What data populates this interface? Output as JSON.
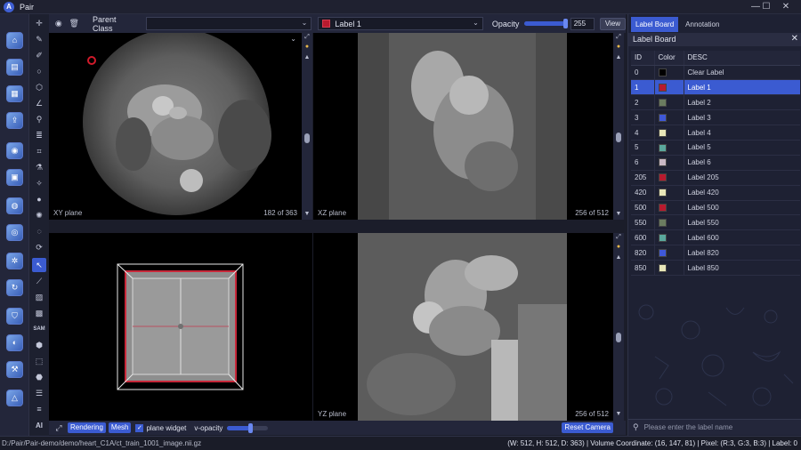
{
  "window": {
    "title": "Pair",
    "logo_letter": "A"
  },
  "window_controls": {
    "minimize": "—",
    "maximize": "☐",
    "close": "✕"
  },
  "top_toolbar": {
    "parent_class_label": "Parent Class",
    "parent_class_value": "",
    "label_select": {
      "text": "Label 1",
      "color": "#b81a2e"
    },
    "opacity_label": "Opacity",
    "opacity_value": "255",
    "opacity_fraction": 1.0,
    "view_button": "View"
  },
  "viewports": {
    "xy": {
      "label": "XY plane",
      "count": "182 of 363"
    },
    "xz": {
      "label": "XZ plane",
      "count": "256 of 512"
    },
    "yz": {
      "label": "YZ plane",
      "count": "256 of 512"
    }
  },
  "viewport_bar": {
    "rendering": "Rendering",
    "mesh": "Mesh",
    "plane_widget": "plane widget",
    "v_opacity_label": "v-opacity",
    "v_opacity_fraction": 0.55,
    "reset_camera": "Reset Camera"
  },
  "tool_column": {
    "sam_label": "SAM",
    "ai_label": "AI"
  },
  "right_panel": {
    "tabs": [
      "Label Board",
      "Annotation"
    ],
    "active_tab": 0,
    "header": "Label Board",
    "columns": [
      "ID",
      "Color",
      "DESC"
    ],
    "labels": [
      {
        "id": "0",
        "color": "#000000",
        "desc": "Clear Label"
      },
      {
        "id": "1",
        "color": "#b81a2e",
        "desc": "Label 1",
        "selected": true
      },
      {
        "id": "2",
        "color": "#6b7c60",
        "desc": "Label 2"
      },
      {
        "id": "3",
        "color": "#3f58d8",
        "desc": "Label 3"
      },
      {
        "id": "4",
        "color": "#e8e6b8",
        "desc": "Label 4"
      },
      {
        "id": "5",
        "color": "#5aa89c",
        "desc": "Label 5"
      },
      {
        "id": "6",
        "color": "#c9b8c4",
        "desc": "Label 6"
      },
      {
        "id": "205",
        "color": "#b81a2e",
        "desc": "Label 205"
      },
      {
        "id": "420",
        "color": "#e8e6b8",
        "desc": "Label 420"
      },
      {
        "id": "500",
        "color": "#b81a2e",
        "desc": "Label 500"
      },
      {
        "id": "550",
        "color": "#6b7c60",
        "desc": "Label 550"
      },
      {
        "id": "600",
        "color": "#5aa89c",
        "desc": "Label 600"
      },
      {
        "id": "820",
        "color": "#3f58d8",
        "desc": "Label 820"
      },
      {
        "id": "850",
        "color": "#e8e6b8",
        "desc": "Label 850"
      }
    ],
    "search_placeholder": "Please enter the label name"
  },
  "status": {
    "path": "D:/Pair/Pair-demo/demo/heart_C1A/ct_train_1001_image.nii.gz",
    "info": "(W: 512, H: 512, D: 363) | Volume Coordinate: (16, 147, 81) | Pixel: (R:3, G:3, B:3) | Label: 0"
  },
  "colors": {
    "accent": "#3b5bd1",
    "label_red": "#b81a2e"
  }
}
